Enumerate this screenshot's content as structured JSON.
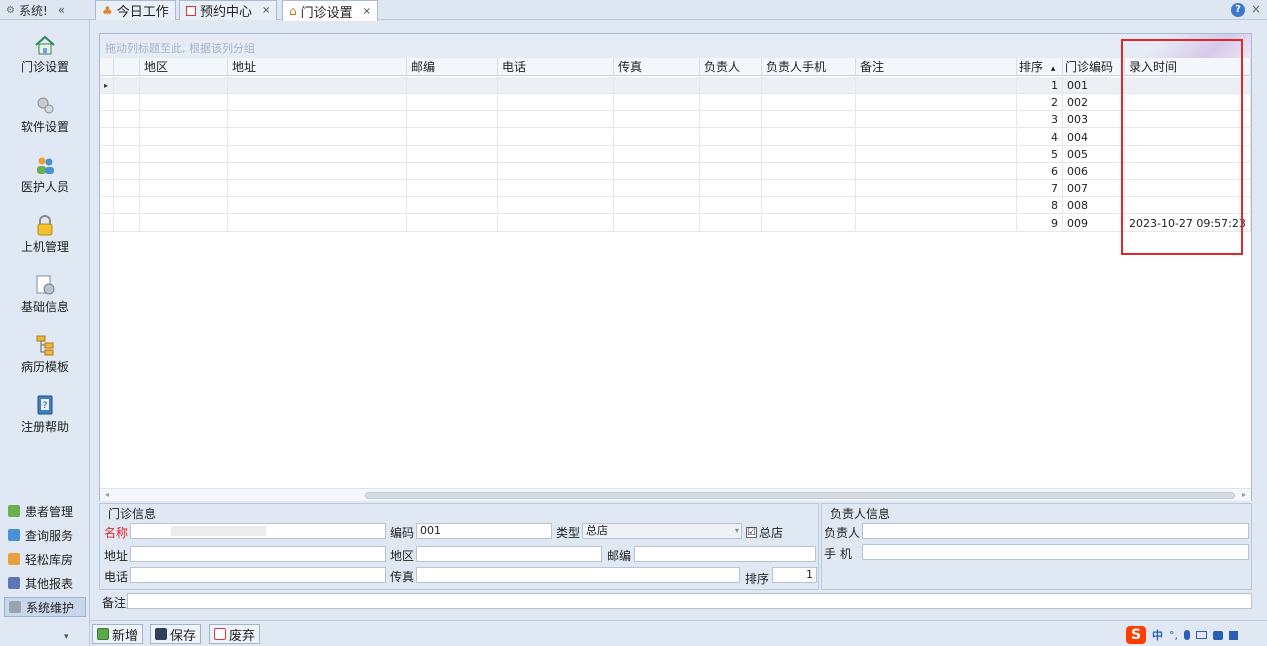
{
  "top": {
    "system_label": "系统!",
    "collapse_label": "«",
    "tabs": [
      {
        "label": "今日工作",
        "icon": "person-icon",
        "closable": false
      },
      {
        "label": "预约中心",
        "icon": "calendar-icon",
        "closable": true
      },
      {
        "label": "门诊设置",
        "icon": "home-icon",
        "closable": true,
        "active": true
      }
    ],
    "close_glyph": "×",
    "help_glyph": "?"
  },
  "sidebar": {
    "items": [
      {
        "label": "门诊设置",
        "icon": "home-icon"
      },
      {
        "label": "软件设置",
        "icon": "gears-icon"
      },
      {
        "label": "医护人员",
        "icon": "staff-icon"
      },
      {
        "label": "上机管理",
        "icon": "lock-icon"
      },
      {
        "label": "基础信息",
        "icon": "settings-doc-icon"
      },
      {
        "label": "病历模板",
        "icon": "tree-icon"
      },
      {
        "label": "注册帮助",
        "icon": "help-book-icon"
      }
    ],
    "modules": [
      {
        "label": "患者管理",
        "icon": "patients-icon"
      },
      {
        "label": "查询服务",
        "icon": "query-icon"
      },
      {
        "label": "轻松库房",
        "icon": "warehouse-icon"
      },
      {
        "label": "其他报表",
        "icon": "report-icon"
      },
      {
        "label": "系统维护",
        "icon": "system-icon",
        "active": true
      }
    ],
    "more_glyph": "▾"
  },
  "grid": {
    "group_hint": "拖动列标题至此, 根据该列分组",
    "columns": [
      "地区",
      "地址",
      "邮编",
      "电话",
      "传真",
      "负责人",
      "负责人手机",
      "备注",
      "排序",
      "门诊编码",
      "录入时间"
    ],
    "sort_glyph": "▴",
    "row_marker": "▸",
    "rows": [
      {
        "order": "1",
        "code": "001",
        "time": ""
      },
      {
        "order": "2",
        "code": "002",
        "time": ""
      },
      {
        "order": "3",
        "code": "003",
        "time": ""
      },
      {
        "order": "4",
        "code": "004",
        "time": ""
      },
      {
        "order": "5",
        "code": "005",
        "time": ""
      },
      {
        "order": "6",
        "code": "006",
        "time": ""
      },
      {
        "order": "7",
        "code": "007",
        "time": ""
      },
      {
        "order": "8",
        "code": "008",
        "time": ""
      },
      {
        "order": "9",
        "code": "009",
        "time": "2023-10-27 09:57:23"
      }
    ],
    "highlight_color": "#e0252b"
  },
  "clinic_info": {
    "title": "门诊信息",
    "name_label": "名称",
    "code_label": "编码",
    "code_value": "001",
    "type_label": "类型",
    "type_value": "总店",
    "head_store_label": "总店",
    "head_store_checked": "☑",
    "address_label": "地址",
    "region_label": "地区",
    "zip_label": "邮编",
    "phone_label": "电话",
    "fax_label": "传真",
    "order_label": "排序",
    "order_value": "1",
    "note_label": "备注"
  },
  "owner_info": {
    "title": "负责人信息",
    "owner_label": "负责人",
    "mobile_label": "手  机"
  },
  "toolbar": {
    "add_label": "新增",
    "save_label": "保存",
    "discard_label": "废弃"
  },
  "ime": {
    "logo": "S",
    "lang": "中",
    "items": [
      "°,",
      "🎤",
      "⌨",
      "👕",
      "⁘"
    ]
  }
}
